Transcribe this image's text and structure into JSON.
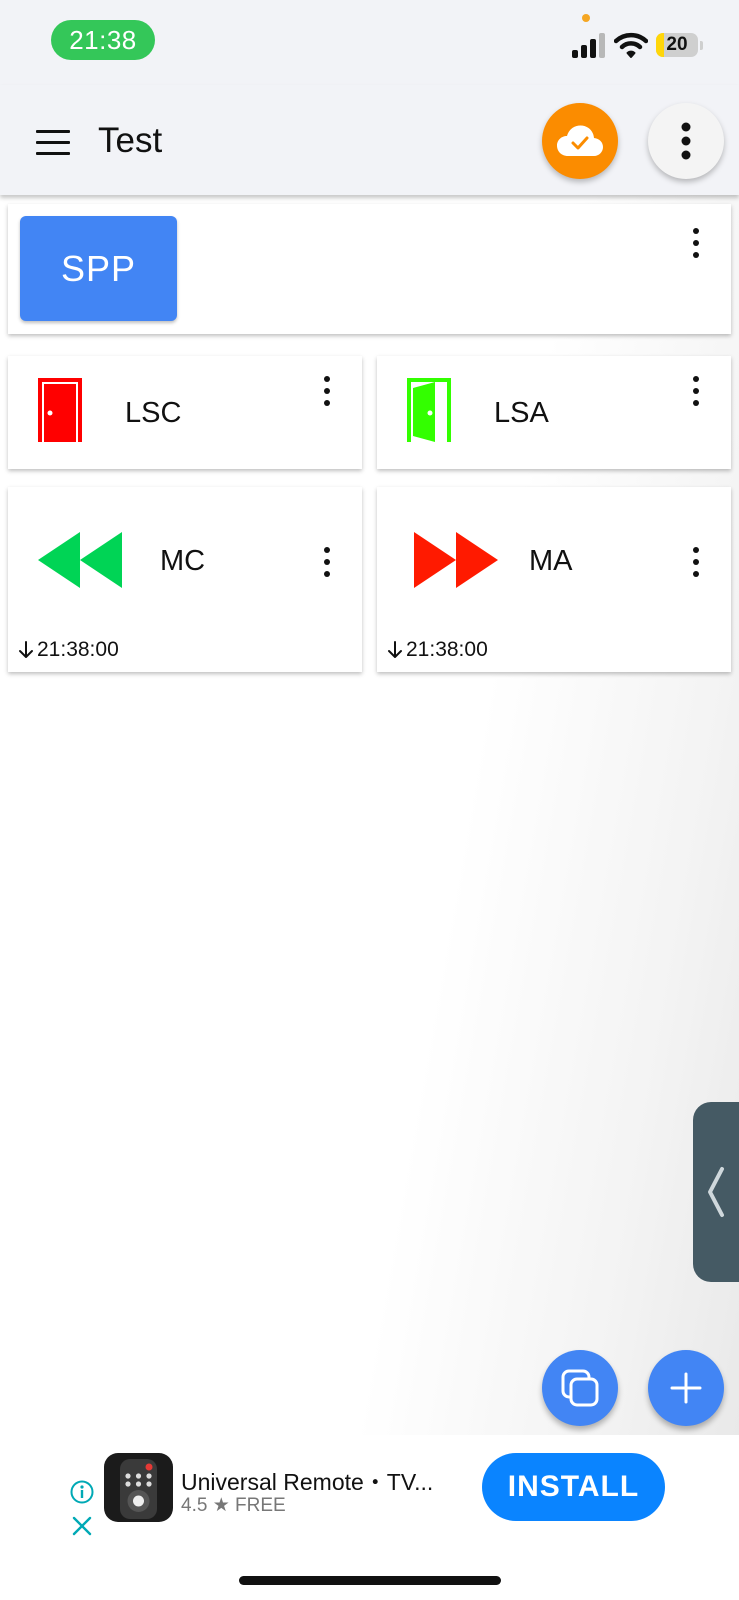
{
  "status_bar": {
    "time": "21:38",
    "battery_level": "20",
    "battery_fraction": 0.2,
    "icons": [
      "signal-icon",
      "wifi-icon",
      "battery-icon"
    ]
  },
  "app_bar": {
    "title": "Test",
    "icons": [
      "menu-icon",
      "cloud-check-icon",
      "more-vert-icon"
    ],
    "cloud_color": "#fb8c00"
  },
  "tiles": {
    "spp": {
      "label": "SPP",
      "color": "#4285f4"
    },
    "lsc": {
      "label": "LSC",
      "icon": "door-closed-icon",
      "icon_color": "#ff0000"
    },
    "lsa": {
      "label": "LSA",
      "icon": "door-open-icon",
      "icon_color": "#33ff00"
    },
    "mc": {
      "label": "MC",
      "icon": "rewind-icon",
      "icon_color": "#00d455",
      "time": "21:38:00"
    },
    "ma": {
      "label": "MA",
      "icon": "fast-forward-icon",
      "icon_color": "#ff1a00",
      "time": "21:38:00"
    }
  },
  "fabs": {
    "icons": [
      "copy-icon",
      "add-icon"
    ],
    "color": "#4285f4"
  },
  "side_handle": {
    "icon": "chevron-left-icon",
    "color": "#455a64"
  },
  "ad": {
    "title": "Universal Remote・TV...",
    "rating": "4.5",
    "price": "FREE",
    "install_label": "INSTALL",
    "icons": [
      "info-icon",
      "close-icon",
      "remote-app-icon",
      "star-icon"
    ],
    "accent": "#0a84ff"
  }
}
